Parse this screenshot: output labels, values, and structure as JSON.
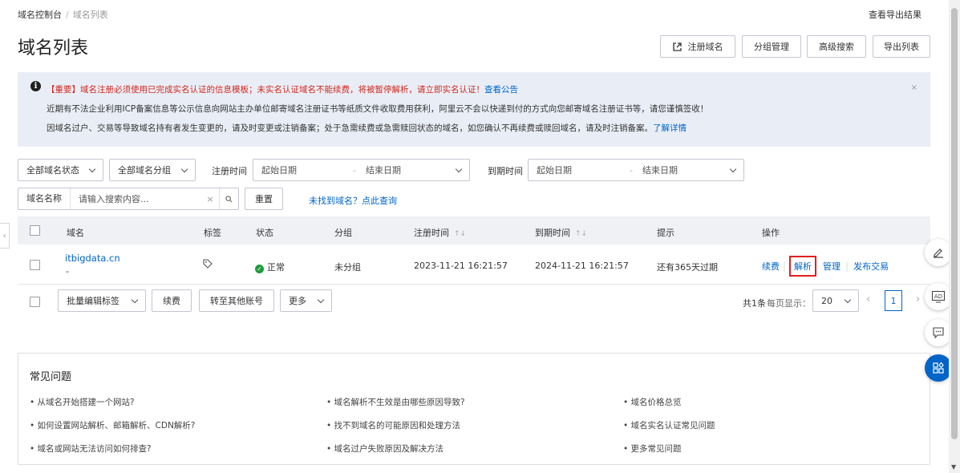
{
  "breadcrumb": {
    "root": "域名控制台",
    "current": "域名列表"
  },
  "header": {
    "export_result": "查看导出结果",
    "title": "域名列表",
    "buttons": {
      "register": "注册域名",
      "group": "分组管理",
      "advanced": "高级搜索",
      "export": "导出列表"
    }
  },
  "notice": {
    "line1": "【重要】域名注册必须使用已完成实名认证的信息模板；未实名认证域名不能续费，将被暂停解析，请立即实名认证！",
    "line1_link": "查看公告",
    "line2": "近期有不法企业利用ICP备案信息等公示信息向网站主办单位邮寄域名注册证书等纸质文件收取费用获利，阿里云不会以快递到付的方式向您邮寄域名注册证书等，请您谨慎签收！",
    "line3": "因域名过户、交易等导致域名持有者发生变更的，请及时变更或注销备案；处于急需续费或急需赎回状态的域名，如您确认不再续费或赎回域名，请及时注销备案。",
    "line3_link": "了解详情",
    "close": "×"
  },
  "filters": {
    "status": "全部域名状态",
    "group": "全部域名分组",
    "reg_time_label": "注册时间",
    "reg_start": "起始日期",
    "reg_dash": "-",
    "reg_end": "结束日期",
    "exp_time_label": "到期时间",
    "exp_start": "起始日期",
    "exp_dash": "-",
    "exp_end": "结束日期",
    "search_type": "域名名称",
    "search_placeholder": "请输入搜索内容...",
    "clear": "×",
    "reset": "重置",
    "not_found_link": "未找到域名？点此查询"
  },
  "table": {
    "headers": {
      "domain": "域名",
      "tag": "标签",
      "status": "状态",
      "group": "分组",
      "reg_time": "注册时间",
      "exp_time": "到期时间",
      "tip": "提示",
      "ops": "操作"
    },
    "sort_glyph": "↑↓",
    "rows": [
      {
        "domain": "itbigdata.cn",
        "sub": "-",
        "status": "正常",
        "group": "未分组",
        "reg_time": "2023-11-21 16:21:57",
        "exp_time": "2024-11-21 16:21:57",
        "tip": "还有365天过期",
        "ops": {
          "renew": "续费",
          "dns": "解析",
          "manage": "管理",
          "trade": "发布交易"
        }
      }
    ]
  },
  "bulk": {
    "edit_tags": "批量编辑标签",
    "renew": "续费",
    "transfer": "转至其他账号",
    "more": "更多",
    "total": "共1条",
    "per_page_label": "每页显示：",
    "per_page": "20",
    "page": "1"
  },
  "faq": {
    "title": "常见问题",
    "items": [
      "• 从域名开始搭建一个网站?",
      "• 域名解析不生效是由哪些原因导致?",
      "• 域名价格总览",
      "• 如何设置网站解析、邮箱解析、CDN解析?",
      "• 找不到域名的可能原因和处理方法",
      "• 域名实名认证常见问题",
      "• 域名或网站无法访问如何排查?",
      "• 域名过户失败原因及解决方法",
      "• 更多常见问题"
    ]
  },
  "colors": {
    "link": "#0064c8",
    "warn": "#d0281f",
    "success": "#1e9c3b",
    "highlight": "#e02020",
    "fab": "#0064c8"
  }
}
